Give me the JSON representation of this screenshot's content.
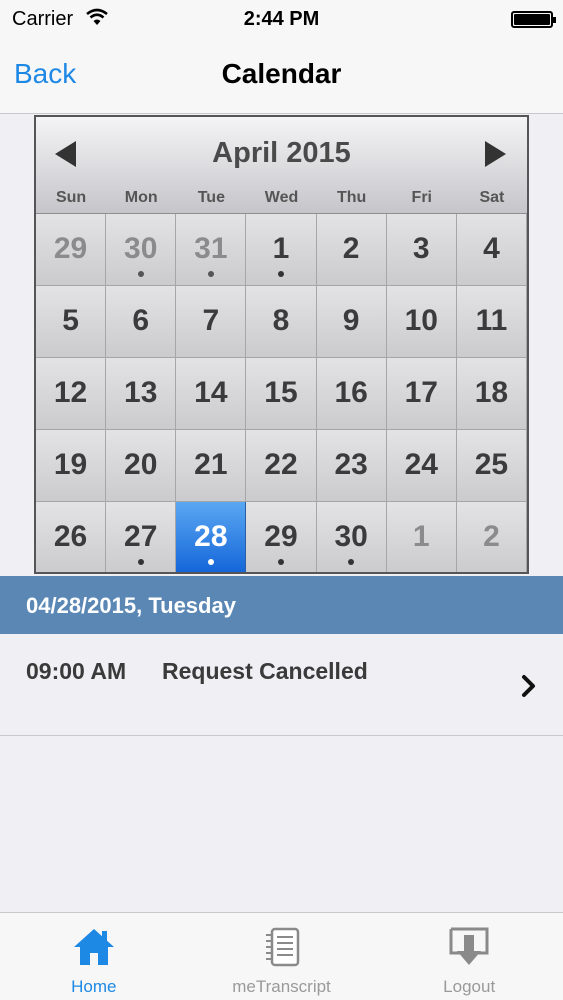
{
  "status_bar": {
    "carrier": "Carrier",
    "time": "2:44 PM"
  },
  "nav": {
    "back_label": "Back",
    "title": "Calendar"
  },
  "calendar": {
    "month_label": "April 2015",
    "weekdays": [
      "Sun",
      "Mon",
      "Tue",
      "Wed",
      "Thu",
      "Fri",
      "Sat"
    ],
    "days": [
      {
        "label": "29",
        "other": true,
        "event": false
      },
      {
        "label": "30",
        "other": true,
        "event": true
      },
      {
        "label": "31",
        "other": true,
        "event": true
      },
      {
        "label": "1",
        "other": false,
        "event": true
      },
      {
        "label": "2",
        "other": false,
        "event": false
      },
      {
        "label": "3",
        "other": false,
        "event": false
      },
      {
        "label": "4",
        "other": false,
        "event": false
      },
      {
        "label": "5",
        "other": false,
        "event": false
      },
      {
        "label": "6",
        "other": false,
        "event": false
      },
      {
        "label": "7",
        "other": false,
        "event": false
      },
      {
        "label": "8",
        "other": false,
        "event": false
      },
      {
        "label": "9",
        "other": false,
        "event": false
      },
      {
        "label": "10",
        "other": false,
        "event": false
      },
      {
        "label": "11",
        "other": false,
        "event": false
      },
      {
        "label": "12",
        "other": false,
        "event": false
      },
      {
        "label": "13",
        "other": false,
        "event": false
      },
      {
        "label": "14",
        "other": false,
        "event": false
      },
      {
        "label": "15",
        "other": false,
        "event": false
      },
      {
        "label": "16",
        "other": false,
        "event": false
      },
      {
        "label": "17",
        "other": false,
        "event": false
      },
      {
        "label": "18",
        "other": false,
        "event": false
      },
      {
        "label": "19",
        "other": false,
        "event": false
      },
      {
        "label": "20",
        "other": false,
        "event": false
      },
      {
        "label": "21",
        "other": false,
        "event": false
      },
      {
        "label": "22",
        "other": false,
        "event": false
      },
      {
        "label": "23",
        "other": false,
        "event": false
      },
      {
        "label": "24",
        "other": false,
        "event": false
      },
      {
        "label": "25",
        "other": false,
        "event": false
      },
      {
        "label": "26",
        "other": false,
        "event": false
      },
      {
        "label": "27",
        "other": false,
        "event": true
      },
      {
        "label": "28",
        "other": false,
        "event": true,
        "selected": true
      },
      {
        "label": "29",
        "other": false,
        "event": true
      },
      {
        "label": "30",
        "other": false,
        "event": true
      },
      {
        "label": "1",
        "other": true,
        "event": false
      },
      {
        "label": "2",
        "other": true,
        "event": false
      }
    ]
  },
  "selected_date": {
    "label": "04/28/2015, Tuesday"
  },
  "events": [
    {
      "time": "09:00 AM",
      "title": "Request Cancelled"
    }
  ],
  "tabs": [
    {
      "label": "Home",
      "icon": "home-icon",
      "active": true
    },
    {
      "label": "meTranscript",
      "icon": "notepad-icon",
      "active": false
    },
    {
      "label": "Logout",
      "icon": "logout-icon",
      "active": false
    }
  ],
  "colors": {
    "accent": "#1e88e5",
    "date_header": "#5b87b5",
    "selected_day": "#1466d9"
  }
}
